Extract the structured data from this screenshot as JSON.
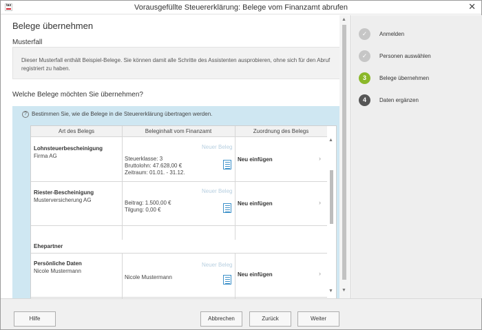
{
  "window": {
    "title": "Vorausgefüllte Steuererklärung: Belege vom Finanzamt abrufen",
    "app_icon_text": "tax",
    "close_glyph": "✕"
  },
  "page": {
    "title": "Belege übernehmen",
    "musterfall_label": "Musterfall",
    "musterfall_text": "Dieser Musterfall enthält Beispiel-Belege. Sie können damit alle Schritte des Assistenten ausprobieren, ohne sich für den Abruf registriert zu haben.",
    "question": "Welche Belege möchten Sie übernehmen?",
    "hint": "Bestimmen Sie, wie die Belege in die Steuererklärung übertragen werden.",
    "hint_icon_glyph": "?"
  },
  "table": {
    "columns": [
      "Art des Belegs",
      "Beleginhalt vom Finanzamt",
      "Zuordnung des Belegs"
    ],
    "rows": [
      {
        "name": "Lohnsteuerbescheinigung",
        "sub": "Firma AG",
        "badge": "Neuer Beleg",
        "detail": [
          "Steuerklasse: 3",
          "Bruttolohn: 47.628,00 €",
          "Zeitraum: 01.01. - 31.12."
        ],
        "assignment": "Neu einfügen",
        "icon": "document-list-icon"
      },
      {
        "name": "Riester-Bescheinigung",
        "sub": "Musterversicherung AG",
        "badge": "Neuer Beleg",
        "detail": [
          "Beitrag: 1.500,00 €",
          "Tilgung: 0,00 €"
        ],
        "assignment": "Neu einfügen",
        "icon": "document-list-icon"
      },
      {
        "name": "Persönliche Daten",
        "sub": "Nicole Mustermann",
        "badge": "Neuer Beleg",
        "detail": [
          "Nicole Mustermann"
        ],
        "assignment": "Neu einfügen",
        "icon": "document-list-icon"
      }
    ],
    "group": "Ehepartner",
    "chevron_glyph": "›"
  },
  "steps": [
    {
      "num": "✓",
      "label": "Anmelden",
      "state": "done"
    },
    {
      "num": "✓",
      "label": "Personen auswählen",
      "state": "done"
    },
    {
      "num": "3",
      "label": "Belege übernehmen",
      "state": "current"
    },
    {
      "num": "4",
      "label": "Daten ergänzen",
      "state": "todo"
    }
  ],
  "footer": {
    "help": "Hilfe",
    "cancel": "Abbrechen",
    "back": "Zurück",
    "next": "Weiter"
  },
  "colors": {
    "accent_step": "#8bb82a",
    "hint_background": "#cfe7f2",
    "doc_icon": "#3a8fc8"
  }
}
